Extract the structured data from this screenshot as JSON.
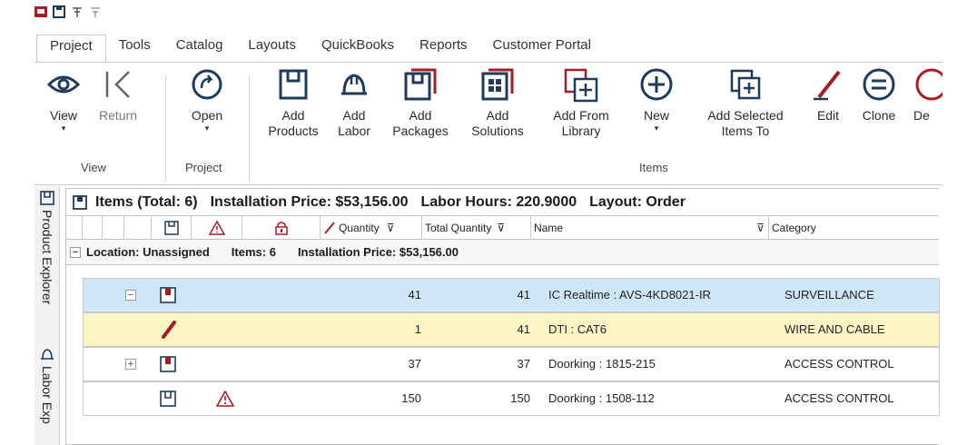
{
  "colors": {
    "accent_red": "#a51d24",
    "selected_row": "#cfe6f6",
    "highlight_row": "#fbf5c6",
    "icon_stroke": "#1f3a5a"
  },
  "ribbon_tabs": [
    "Project",
    "Tools",
    "Catalog",
    "Layouts",
    "QuickBooks",
    "Reports",
    "Customer Portal"
  ],
  "ribbon": {
    "view_label": "View",
    "return_label": "Return",
    "open_label": "Open",
    "add_products_label": "Add\nProducts",
    "add_labor_label": "Add\nLabor",
    "add_packages_label": "Add\nPackages",
    "add_solutions_label": "Add\nSolutions",
    "add_from_library_label": "Add From\nLibrary",
    "new_label": "New",
    "add_selected_label": "Add Selected\nItems To",
    "edit_label": "Edit",
    "clone_label": "Clone",
    "delete_label_partial": "De",
    "group_view": "View",
    "group_project": "Project",
    "group_items": "Items"
  },
  "side_tabs": [
    "Product Explorer",
    "Labor Exp"
  ],
  "grid": {
    "summary": {
      "items_total": "Items (Total: 6)",
      "installation_price": "Installation Price: $53,156.00",
      "labor_hours": "Labor Hours: 220.9000",
      "layout": "Layout: Order"
    },
    "columns": {
      "quantity": "Quantity",
      "total_quantity": "Total Quantity",
      "name": "Name",
      "category": "Category"
    },
    "group": {
      "location": "Location: Unassigned",
      "items": "Items: 6",
      "installation_price": "Installation Price: $53,156.00"
    },
    "rows": [
      {
        "quantity": "41",
        "total_quantity": "41",
        "name": "IC Realtime : AVS-4KD8021-IR",
        "category": "SURVEILLANCE"
      },
      {
        "quantity": "1",
        "total_quantity": "41",
        "name": "DTI : CAT6",
        "category": "WIRE AND CABLE"
      },
      {
        "quantity": "37",
        "total_quantity": "37",
        "name": "Doorking : 1815-215",
        "category": "ACCESS CONTROL"
      },
      {
        "quantity": "150",
        "total_quantity": "150",
        "name": "Doorking : 1508-112",
        "category": "ACCESS CONTROL"
      }
    ]
  }
}
